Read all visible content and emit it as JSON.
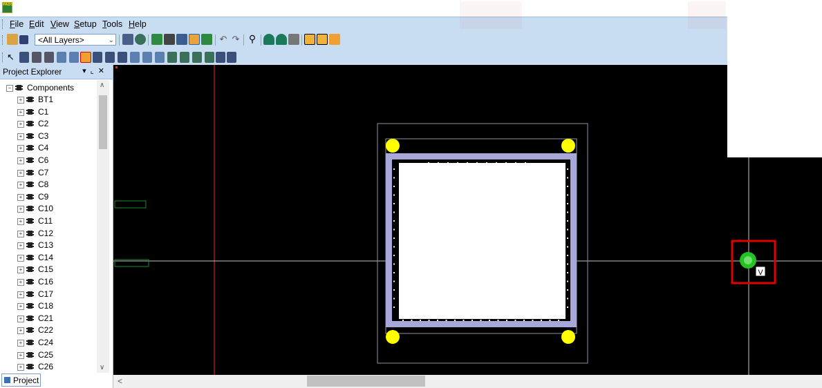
{
  "app": {
    "icon_text": "PADS"
  },
  "menu": [
    {
      "label": "File",
      "hotkey": "F"
    },
    {
      "label": "Edit",
      "hotkey": "E"
    },
    {
      "label": "View",
      "hotkey": "V"
    },
    {
      "label": "Setup",
      "hotkey": "S"
    },
    {
      "label": "Tools",
      "hotkey": "T"
    },
    {
      "label": "Help",
      "hotkey": "H"
    }
  ],
  "toolbar": {
    "layer_select_value": "<All Layers>"
  },
  "explorer": {
    "title": "Project Explorer",
    "root_label": "Components",
    "items": [
      "BT1",
      "C1",
      "C2",
      "C3",
      "C4",
      "C6",
      "C7",
      "C8",
      "C9",
      "C10",
      "C11",
      "C12",
      "C13",
      "C14",
      "C15",
      "C16",
      "C17",
      "C18",
      "C21",
      "C22",
      "C24",
      "C25",
      "C26"
    ],
    "tab_label": "Project"
  },
  "canvas": {
    "cursor_label": "V",
    "colors": {
      "background": "#000000",
      "board_outline": "#a7a7d9",
      "pad": "#ffff00",
      "cursor": "#22c322",
      "highlight": "#e00000"
    }
  }
}
